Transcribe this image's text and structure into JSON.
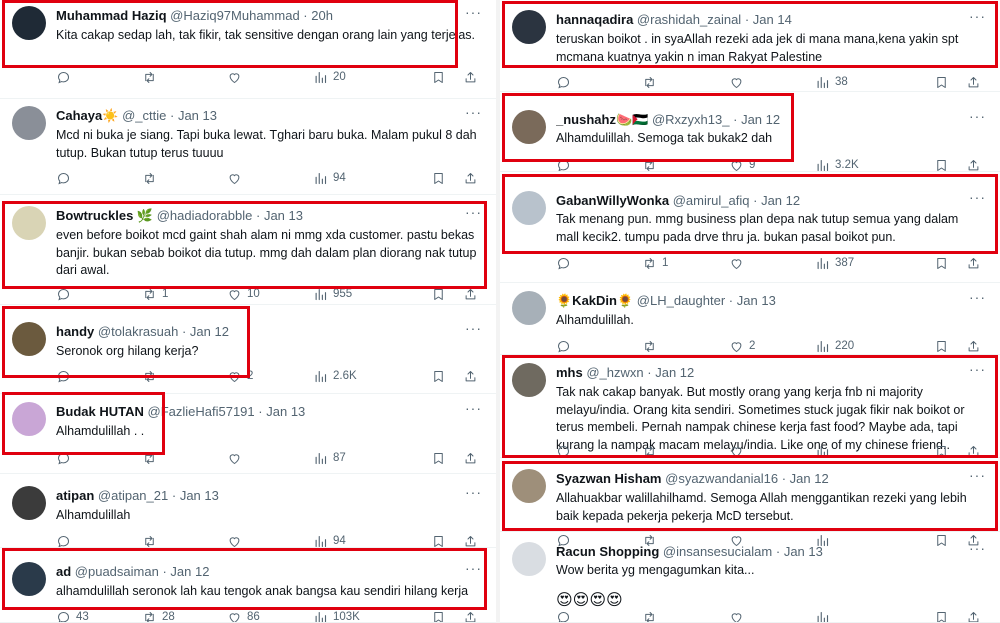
{
  "left_column": [
    {
      "name": "Muhammad Haziq",
      "handle": "@Haziq97Muhammad",
      "time": "20h",
      "text": "Kita cakap sedap lah, tak fikir, tak sensitive dengan orang lain yang terjejas.",
      "replies": "",
      "reposts": "",
      "likes": "",
      "views": "20",
      "avatar_color": "#1f2a36"
    },
    {
      "name": "Cahaya☀️",
      "handle": "@_cttie",
      "time": "Jan 13",
      "text": "Mcd ni buka je siang. Tapi buka lewat. Tghari baru buka. Malam pukul 8 dah tutup. Bukan tutup terus tuuuu",
      "replies": "",
      "reposts": "",
      "likes": "",
      "views": "94",
      "avatar_color": "#8a8f98"
    },
    {
      "name": "Bowtruckles 🌿",
      "handle": "@hadiadorabble",
      "time": "Jan 13",
      "text": "even before boikot mcd gaint shah alam ni mmg xda customer. pastu bekas banjir. bukan sebab boikot dia tutup. mmg dah dalam plan diorang nak tutup dari awal.",
      "replies": "",
      "reposts": "1",
      "likes": "10",
      "views": "955",
      "avatar_color": "#d9d4b5"
    },
    {
      "name": "handy",
      "handle": "@tolakrasuah",
      "time": "Jan 12",
      "text": "Seronok org hilang kerja?",
      "replies": "",
      "reposts": "",
      "likes": "2",
      "views": "2.6K",
      "avatar_color": "#6b5a3e"
    },
    {
      "name": "Budak HUTAN",
      "handle": "@FazlieHafi57191",
      "time": "Jan 13",
      "text": "Alhamdulillah . .",
      "replies": "",
      "reposts": "",
      "likes": "",
      "views": "87",
      "avatar_color": "#c9a6d6"
    },
    {
      "name": "atipan",
      "handle": "@atipan_21",
      "time": "Jan 13",
      "text": "Alhamdulillah",
      "replies": "",
      "reposts": "",
      "likes": "",
      "views": "94",
      "avatar_color": "#3b3b3b"
    },
    {
      "name": "ad",
      "handle": "@puadsaiman",
      "time": "Jan 12",
      "text": "alhamdulillah seronok lah kau tengok anak bangsa kau sendiri hilang kerja",
      "replies": "43",
      "reposts": "28",
      "likes": "86",
      "views": "103K",
      "avatar_color": "#2a3a4a"
    }
  ],
  "right_column": [
    {
      "name": "hannaqadira",
      "handle": "@rashidah_zainal",
      "time": "Jan 14",
      "text": "teruskan boikot . in syaAllah rezeki ada jek di mana mana,kena yakin spt mcmana kuatnya yakin n iman Rakyat Palestine",
      "replies": "",
      "reposts": "",
      "likes": "",
      "views": "38",
      "avatar_color": "#2b3440"
    },
    {
      "name": "_nushahz🍉🇵🇸",
      "handle": "@Rxzyxh13_",
      "time": "Jan 12",
      "text": "Alhamdulillah. Semoga tak bukak2 dah",
      "replies": "",
      "reposts": "",
      "likes": "9",
      "views": "3.2K",
      "avatar_color": "#7a6a5a"
    },
    {
      "name": "GabanWillyWonka",
      "handle": "@amirul_afiq",
      "time": "Jan 12",
      "text": "Tak menang pun. mmg business plan depa nak tutup semua yang dalam mall kecik2. tumpu pada drve thru ja. bukan pasal boikot pun.",
      "replies": "",
      "reposts": "1",
      "likes": "",
      "views": "387",
      "avatar_color": "#b8c2cc"
    },
    {
      "name": "🌻KakDin🌻",
      "handle": "@LH_daughter",
      "time": "Jan 13",
      "text": "Alhamdulillah.",
      "replies": "",
      "reposts": "",
      "likes": "2",
      "views": "220",
      "avatar_color": "#a7b0b8"
    },
    {
      "name": "mhs",
      "handle": "@_hzwxn",
      "time": "Jan 12",
      "text": "Tak nak cakap banyak. But mostly orang yang kerja fnb ni majority melayu/india. Orang kita sendiri. Sometimes stuck jugak fikir nak boikot or terus membeli. Pernah nampak chinese kerja fast food? Maybe ada, tapi kurang la nampak macam melayu/india. Like one of my chinese friend..",
      "replies": "",
      "reposts": "",
      "likes": "",
      "views": "",
      "avatar_color": "#6f6a60"
    },
    {
      "name": "Syazwan Hisham",
      "handle": "@syazwandanial16",
      "time": "Jan 12",
      "text": "Allahuakbar walillahilhamd. Semoga Allah menggantikan rezeki yang lebih baik kepada pekerja pekerja McD tersebut.",
      "replies": "",
      "reposts": "",
      "likes": "",
      "views": "",
      "avatar_color": "#9e8f7a"
    },
    {
      "name": "Racun Shopping",
      "handle": "@insansesucialam",
      "time": "Jan 13",
      "text": "Wow berita yg mengagumkan kita...",
      "emoji": "😍😍😍😍",
      "replies": "",
      "reposts": "",
      "likes": "",
      "views": "",
      "avatar_color": "#d9dde2"
    }
  ],
  "ui": {
    "separator": "·",
    "more_label": "···",
    "highlight_color": "#e0000f",
    "text_secondary": "#536471"
  }
}
